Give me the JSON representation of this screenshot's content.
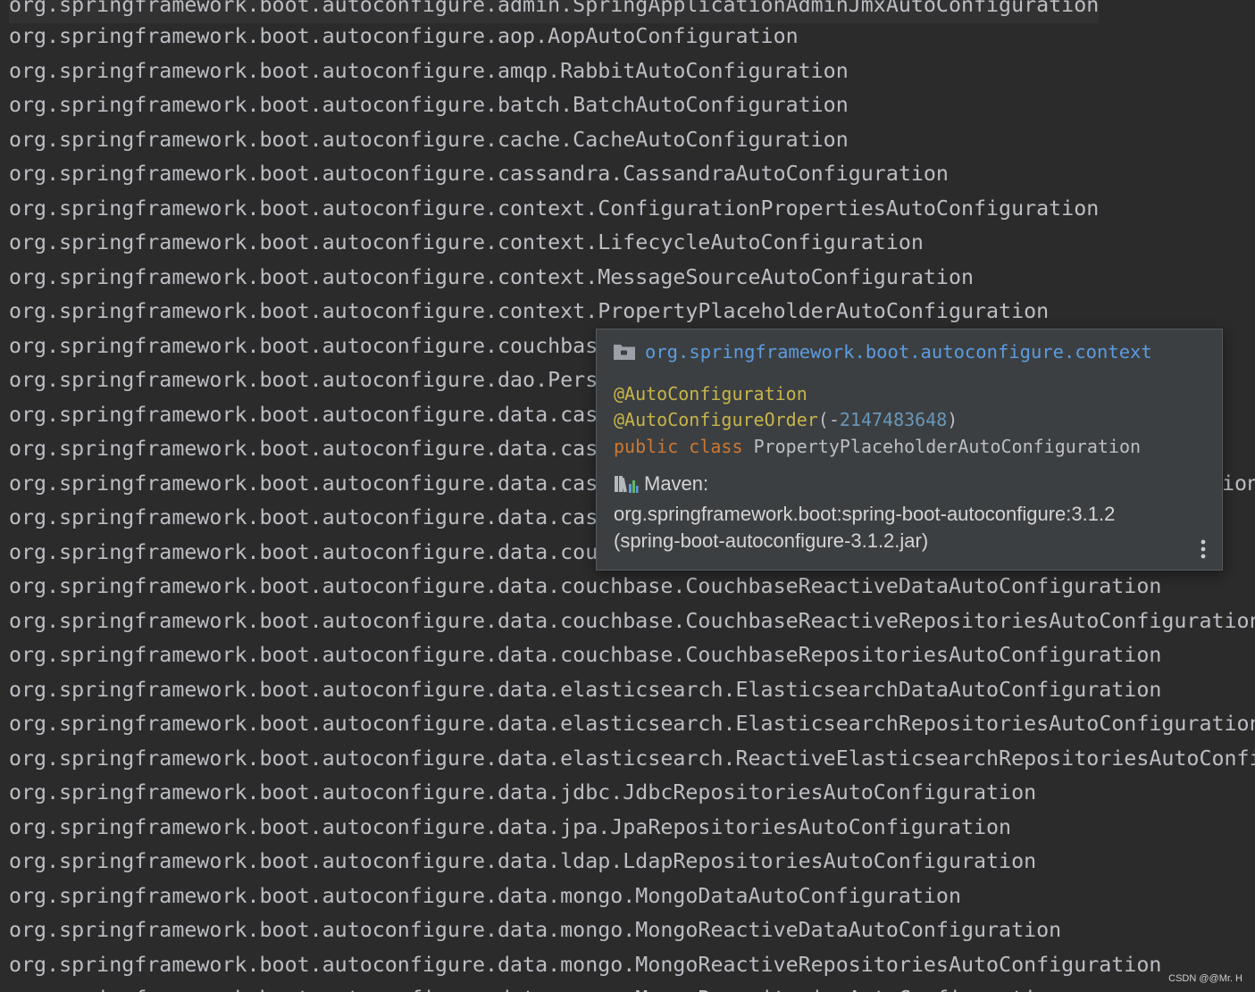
{
  "editor": {
    "lines": [
      "org.springframework.boot.autoconfigure.admin.SpringApplicationAdminJmxAutoConfiguration",
      "org.springframework.boot.autoconfigure.aop.AopAutoConfiguration",
      "org.springframework.boot.autoconfigure.amqp.RabbitAutoConfiguration",
      "org.springframework.boot.autoconfigure.batch.BatchAutoConfiguration",
      "org.springframework.boot.autoconfigure.cache.CacheAutoConfiguration",
      "org.springframework.boot.autoconfigure.cassandra.CassandraAutoConfiguration",
      "org.springframework.boot.autoconfigure.context.ConfigurationPropertiesAutoConfiguration",
      "org.springframework.boot.autoconfigure.context.LifecycleAutoConfiguration",
      "org.springframework.boot.autoconfigure.context.MessageSourceAutoConfiguration",
      "org.springframework.boot.autoconfigure.context.PropertyPlaceholderAutoConfiguration",
      "org.springframework.boot.autoconfigure.couchbas",
      "org.springframework.boot.autoconfigure.dao.Pers",
      "org.springframework.boot.autoconfigure.data.cas",
      "org.springframework.boot.autoconfigure.data.cas",
      "org.springframework.boot.autoconfigure.data.cas",
      "org.springframework.boot.autoconfigure.data.cas",
      "org.springframework.boot.autoconfigure.data.cou",
      "org.springframework.boot.autoconfigure.data.couchbase.CouchbaseReactiveDataAutoConfiguration",
      "org.springframework.boot.autoconfigure.data.couchbase.CouchbaseReactiveRepositoriesAutoConfiguration",
      "org.springframework.boot.autoconfigure.data.couchbase.CouchbaseRepositoriesAutoConfiguration",
      "org.springframework.boot.autoconfigure.data.elasticsearch.ElasticsearchDataAutoConfiguration",
      "org.springframework.boot.autoconfigure.data.elasticsearch.ElasticsearchRepositoriesAutoConfiguration",
      "org.springframework.boot.autoconfigure.data.elasticsearch.ReactiveElasticsearchRepositoriesAutoConfiguration",
      "org.springframework.boot.autoconfigure.data.jdbc.JdbcRepositoriesAutoConfiguration",
      "org.springframework.boot.autoconfigure.data.jpa.JpaRepositoriesAutoConfiguration",
      "org.springframework.boot.autoconfigure.data.ldap.LdapRepositoriesAutoConfiguration",
      "org.springframework.boot.autoconfigure.data.mongo.MongoDataAutoConfiguration",
      "org.springframework.boot.autoconfigure.data.mongo.MongoReactiveDataAutoConfiguration",
      "org.springframework.boot.autoconfigure.data.mongo.MongoReactiveRepositoriesAutoConfiguration",
      "org.springframework.boot.autoconfigure.data.mongo.MongoRepositoriesAutoConfiguration"
    ],
    "overflow_tail": "ion"
  },
  "popup": {
    "package": "org.springframework.boot.autoconfigure.context",
    "annotation_1": "@AutoConfiguration",
    "annotation_2": "@AutoConfigureOrder",
    "annotation_2_open": "(-",
    "annotation_2_value": "2147483648",
    "annotation_2_close": ")",
    "keyword_public": "public",
    "keyword_class": "class",
    "class_name": "PropertyPlaceholderAutoConfiguration",
    "maven_label": "Maven:",
    "maven_coordinates": "org.springframework.boot:spring-boot-autoconfigure:3.1.2",
    "maven_jar": "(spring-boot-autoconfigure-3.1.2.jar)",
    "icons": {
      "package": "folder-icon",
      "library": "maven-library-icon",
      "menu": "more-vertical-icon"
    }
  },
  "watermark": "CSDN @@Mr. H",
  "colors": {
    "editor_bg": "#2b2b2b",
    "code_text": "#bcbec4",
    "popup_bg": "#3c3f41",
    "package_link": "#5c9ce0",
    "annotation": "#c7b54a",
    "keyword": "#cc7832",
    "number": "#6897bb"
  }
}
